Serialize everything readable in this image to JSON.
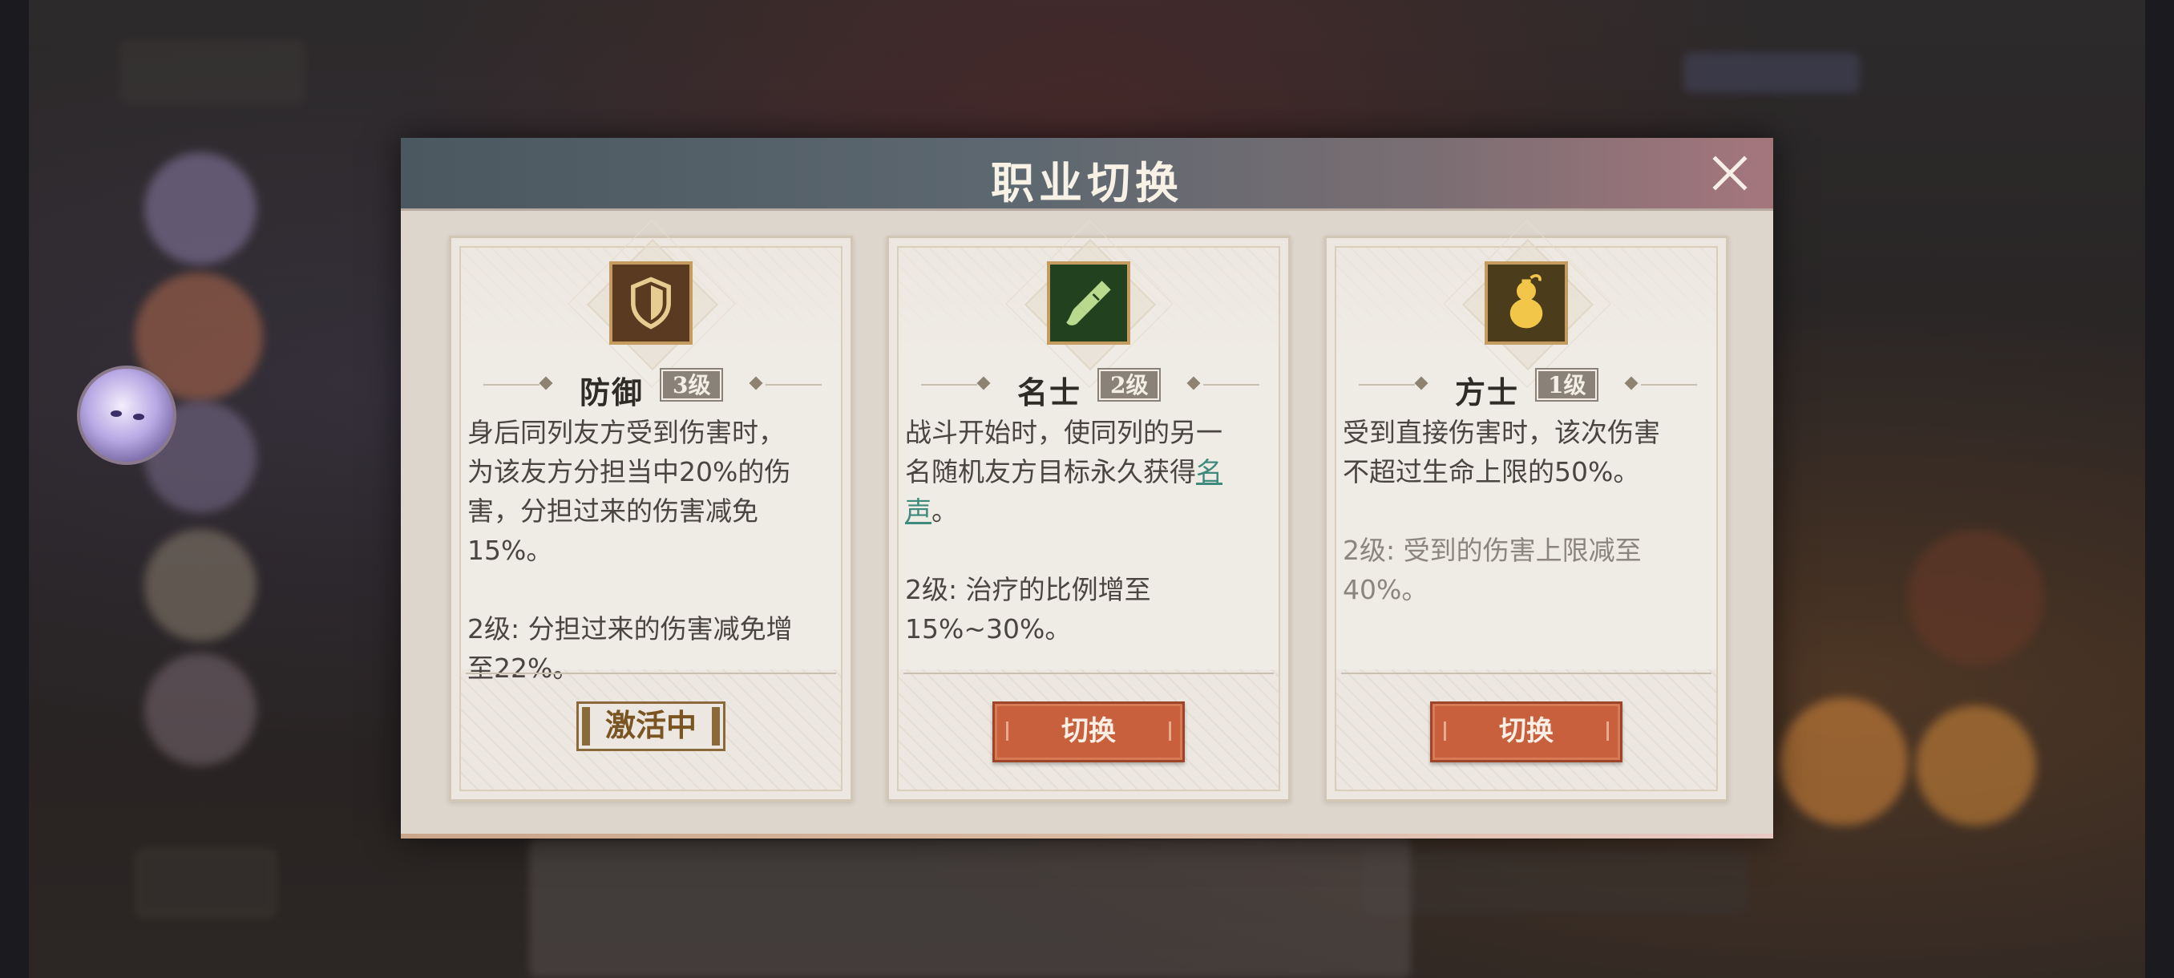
{
  "dialog": {
    "title": "职业切换",
    "close_icon": "close-icon"
  },
  "cards": [
    {
      "icon": "shield-icon",
      "icon_bg": "#5a3b22",
      "class_name": "防御",
      "level": "3级",
      "desc": [
        "身后同列友方受到伤害时，",
        "为该友方分担当中20%的伤",
        "害，分担过来的伤害减免",
        "15%。"
      ],
      "upgrade": [
        "2级: 分担过来的伤害减免增",
        "至22%。"
      ],
      "status": "激活中"
    },
    {
      "icon": "brush-icon",
      "icon_bg": "#22421f",
      "class_name": "名士",
      "level": "2级",
      "desc_line1": "战斗开始时，使同列的另一",
      "desc_line2_prefix": "名随机友方目标永久获得",
      "desc_line2_link": "名",
      "desc_line3_link": "声",
      "desc_line3_suffix": "。",
      "upgrade": [
        "2级: 治疗的比例增至",
        "15%~30%。"
      ],
      "button": "切换"
    },
    {
      "icon": "gourd-icon",
      "icon_bg": "#4b3c1c",
      "class_name": "方士",
      "level": "1级",
      "desc": [
        "受到直接伤害时，该次伤害",
        "不超过生命上限的50%。"
      ],
      "upgrade": [
        "2级: 受到的伤害上限减至",
        "40%。"
      ],
      "button": "切换"
    }
  ],
  "colors": {
    "button": "#c9603d",
    "link": "#3e8a7d",
    "active": "#8a6a3b"
  }
}
